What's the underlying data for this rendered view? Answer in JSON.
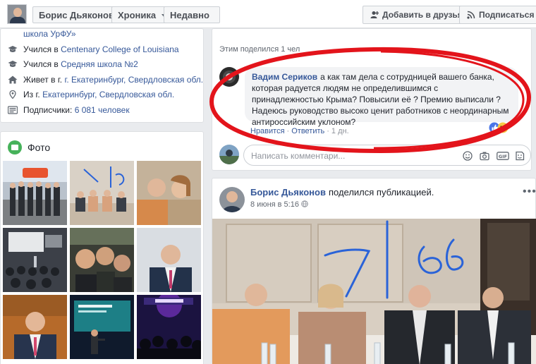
{
  "topbar": {
    "profile_name": "Борис Дьяконов",
    "timeline_label": "Хроника",
    "recent_label": "Недавно",
    "add_friend_label": "Добавить в друзья",
    "subscribe_label": "Подписаться"
  },
  "intro": {
    "school_prev": "школа УрФУ»",
    "studied_prefix": "Учился в",
    "college": "Centenary College of Louisiana",
    "school2": "Средняя школа №2",
    "lives_prefix": "Живет в г.",
    "lives_city": "г. Екатеринбург, Свердловская обл.",
    "from_prefix": "Из г.",
    "from_city": "Екатеринбург, Свердловская обл.",
    "followers_prefix": "Подписчики:",
    "followers_count": "6 081 человек"
  },
  "photos": {
    "title": "Фото"
  },
  "post1": {
    "shared_by": "Этим поделился 1 чел",
    "comment": {
      "author": "Вадим Сериков",
      "text": "а как там дела с сотрудницей вашего банка, которая радуется людям не определившимся с принадлежностью Крыма? Повысили её ? Премию выписали ? Надеюсь руководство высоко ценит работников с неординарным антироссийским уклоном?",
      "like_action": "Нравится",
      "reply_action": "Ответить",
      "time": "1 дн."
    },
    "write_placeholder": "Написать комментари..."
  },
  "post2": {
    "author": "Борис Дьяконов",
    "action_text": "поделился публикацией.",
    "date": "8 июня в 5:16",
    "more": "•••"
  },
  "colors": {
    "brand_link": "#365899",
    "highlight_red": "#e3141b",
    "pen_blue": "#2a63d8"
  }
}
